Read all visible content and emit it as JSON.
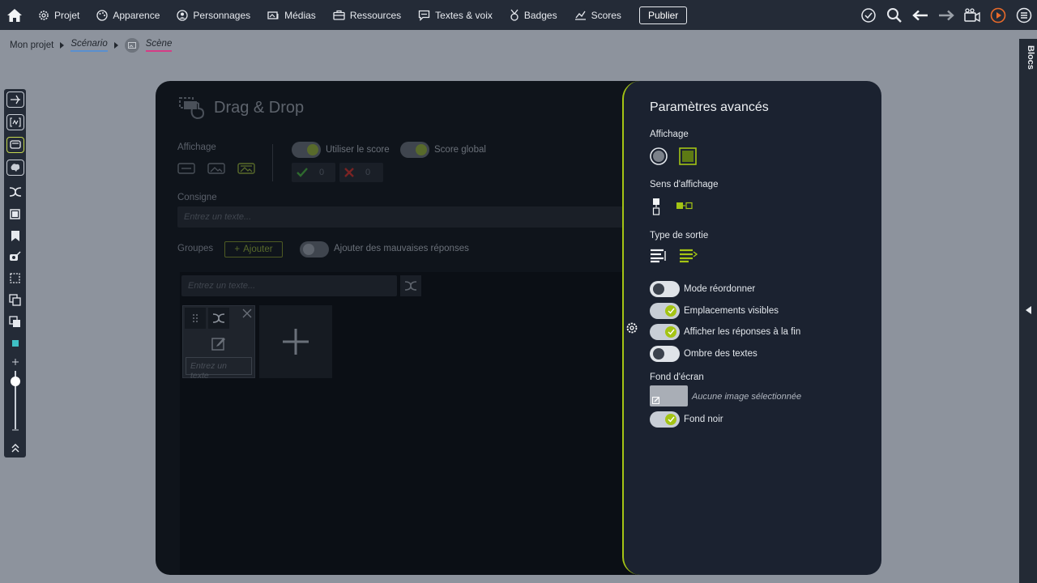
{
  "topbar": {
    "nav": [
      {
        "label": "Projet",
        "icon": "gear-icon"
      },
      {
        "label": "Apparence",
        "icon": "palette-icon"
      },
      {
        "label": "Personnages",
        "icon": "person-icon"
      },
      {
        "label": "Médias",
        "icon": "media-icon"
      },
      {
        "label": "Ressources",
        "icon": "briefcase-icon"
      },
      {
        "label": "Textes & voix",
        "icon": "speech-icon"
      },
      {
        "label": "Badges",
        "icon": "badge-icon"
      },
      {
        "label": "Scores",
        "icon": "chart-icon"
      }
    ],
    "publish_label": "Publier"
  },
  "breadcrumb": {
    "project": "Mon projet",
    "scenario": "Scénario",
    "scene": "Scène"
  },
  "blocs_label": "Blocs",
  "editor": {
    "title": "Drag & Drop",
    "affichage_label": "Affichage",
    "use_score_label": "Utiliser le score",
    "global_score_label": "Score global",
    "correct_count": "0",
    "wrong_count": "0",
    "consigne_label": "Consigne",
    "consigne_placeholder": "Entrez un texte...",
    "groupes_label": "Groupes",
    "add_label": "Ajouter",
    "bad_answers_label": "Ajouter des mauvaises réponses",
    "group_input_placeholder": "Entrez un texte...",
    "group_card_placeholder": "Entrez un texte"
  },
  "panel": {
    "title": "Paramètres avancés",
    "affichage_label": "Affichage",
    "sens_label": "Sens d'affichage",
    "sortie_label": "Type de sortie",
    "toggles": [
      {
        "label": "Mode réordonner",
        "on": false
      },
      {
        "label": "Emplacements visibles",
        "on": true
      },
      {
        "label": "Afficher les réponses à la fin",
        "on": true
      },
      {
        "label": "Ombre des textes",
        "on": false
      }
    ],
    "fond_label": "Fond d'écran",
    "no_image": "Aucune image sélectionnée",
    "fond_noir_label": "Fond noir",
    "fond_noir_on": true,
    "accent": "#a4c414"
  }
}
